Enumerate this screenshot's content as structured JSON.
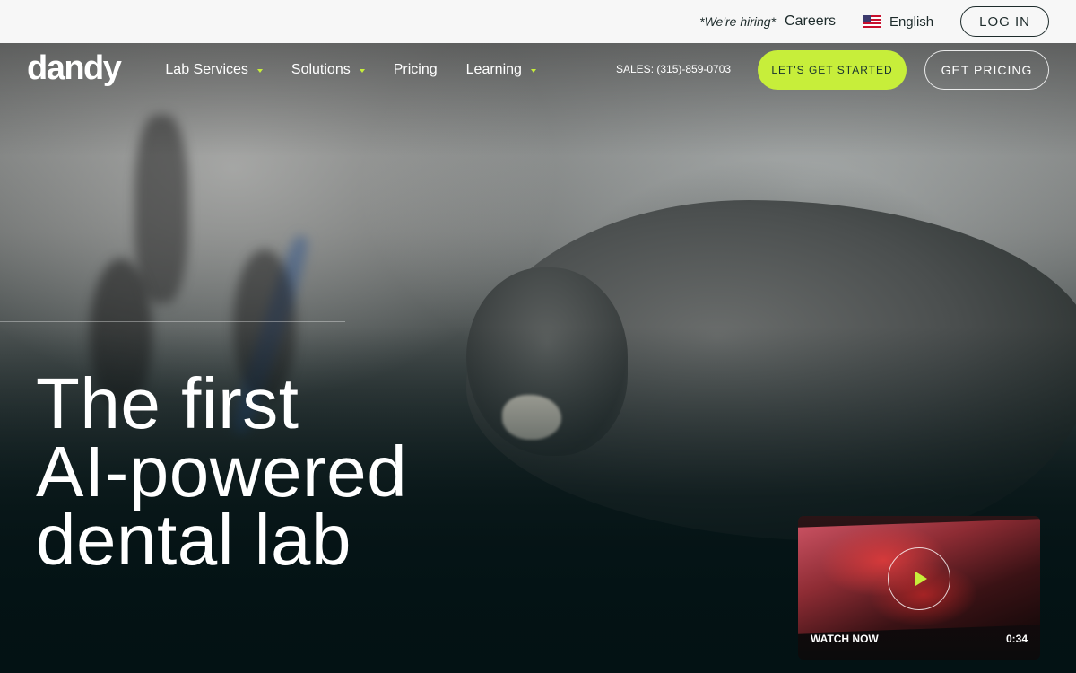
{
  "topbar": {
    "hiring": "*We're hiring*",
    "careers": "Careers",
    "language": "English",
    "login": "LOG IN"
  },
  "nav": {
    "logo": "dandy",
    "items": [
      {
        "label": "Lab Services",
        "has_dropdown": true
      },
      {
        "label": "Solutions",
        "has_dropdown": true
      },
      {
        "label": "Pricing",
        "has_dropdown": false
      },
      {
        "label": "Learning",
        "has_dropdown": true
      }
    ],
    "sales": "SALES: (315)-859-0703",
    "cta_primary": "LET'S GET STARTED",
    "cta_secondary": "GET PRICING"
  },
  "hero": {
    "headline_lines": [
      "The first",
      "AI-powered",
      "dental lab"
    ]
  },
  "video": {
    "label": "WATCH NOW",
    "duration": "0:34"
  },
  "colors": {
    "accent": "#c7ee3a",
    "dark": "#173130",
    "topbar_bg": "#f7f7f7"
  },
  "icons": {
    "flag": "us-flag-icon",
    "dropdown": "chevron-down-icon",
    "play": "play-icon"
  }
}
